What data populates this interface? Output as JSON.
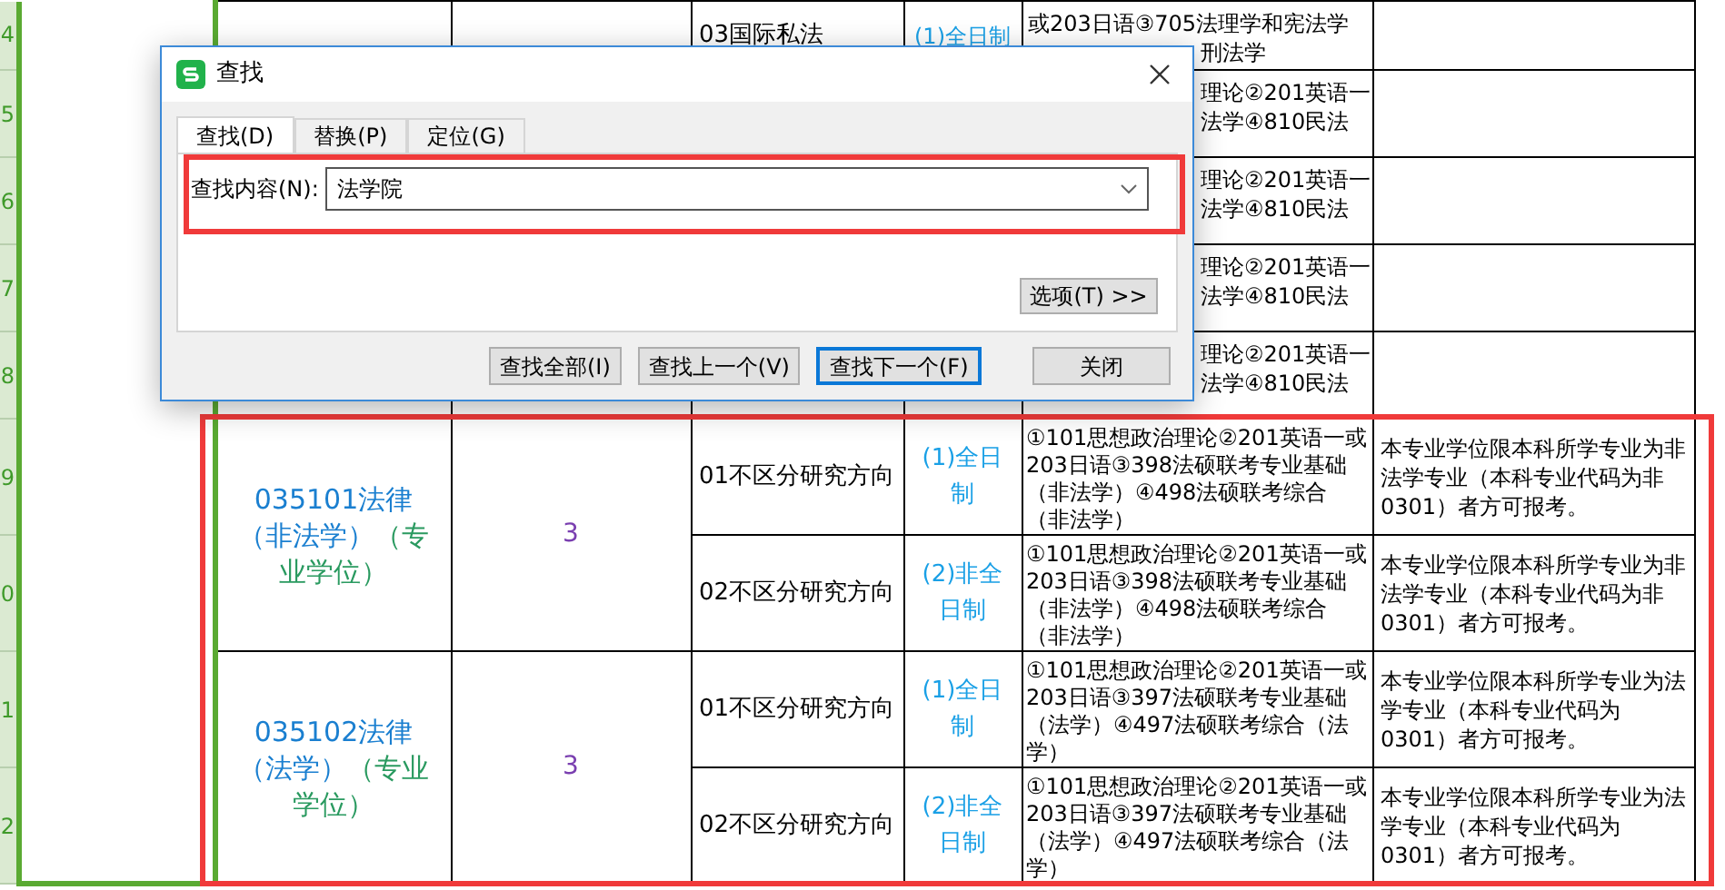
{
  "row_headers": [
    "4",
    "5",
    "6",
    "7",
    "8",
    "9",
    "0",
    "1",
    "2"
  ],
  "top_rows": [
    {
      "direction": "03国际私法",
      "mode": "(1)全日制",
      "exam_lines": [
        {
          "kind": "full",
          "text": "或203日语③705法理学和宪法学"
        },
        {
          "kind": "covered",
          "text": "刑法学"
        }
      ]
    },
    {
      "exam_lines": [
        {
          "kind": "covered",
          "text": "理论②201英语一"
        },
        {
          "kind": "covered",
          "text": "法学④810民法"
        }
      ]
    },
    {
      "exam_lines": [
        {
          "kind": "covered",
          "text": "理论②201英语一"
        },
        {
          "kind": "covered",
          "text": "法学④810民法"
        }
      ]
    },
    {
      "exam_lines": [
        {
          "kind": "covered",
          "text": "理论②201英语一"
        },
        {
          "kind": "covered",
          "text": "法学④810民法"
        }
      ]
    },
    {
      "exam_lines": [
        {
          "kind": "covered",
          "text": "理论②201英语一"
        },
        {
          "kind": "covered",
          "text": "法学④810民法"
        }
      ]
    }
  ],
  "programs": [
    {
      "name": "035101法律（非法学）",
      "degree": "（专业学位）",
      "count": "3",
      "directions": [
        {
          "direction": "01不区分研究方向",
          "mode": "(1)全日制",
          "exams": "①101思想政治理论②201英语一或203日语③398法硕联考专业基础（非法学）④498法硕联考综合（非法学）",
          "note": "本专业学位限本科所学专业为非法学专业（本科专业代码为非0301）者方可报考。"
        },
        {
          "direction": "02不区分研究方向",
          "mode": "(2)非全日制",
          "exams": "①101思想政治理论②201英语一或203日语③398法硕联考专业基础（非法学）④498法硕联考综合（非法学）",
          "note": "本专业学位限本科所学专业为非法学专业（本科专业代码为非0301）者方可报考。"
        }
      ]
    },
    {
      "name": "035102法律（法学）",
      "degree": "（专业学位）",
      "count": "3",
      "directions": [
        {
          "direction": "01不区分研究方向",
          "mode": "(1)全日制",
          "exams": "①101思想政治理论②201英语一或203日语③397法硕联考专业基础（法学）④497法硕联考综合（法学）",
          "note": "本专业学位限本科所学专业为法学专业（本科专业代码为0301）者方可报考。"
        },
        {
          "direction": "02不区分研究方向",
          "mode": "(2)非全日制",
          "exams": "①101思想政治理论②201英语一或203日语③397法硕联考专业基础（法学）④497法硕联考综合（法学）",
          "note": "本专业学位限本科所学专业为法学专业（本科专业代码为0301）者方可报考。"
        }
      ]
    }
  ],
  "dialog": {
    "title": "查找",
    "tabs": [
      {
        "label": "查找(D)",
        "selected": true
      },
      {
        "label": "替换(P)",
        "selected": false
      },
      {
        "label": "定位(G)",
        "selected": false
      }
    ],
    "find_label": "查找内容(N):",
    "find_value": "法学院",
    "options_button": "选项(T) >>",
    "buttons": [
      {
        "label": "查找全部(I)",
        "focused": false
      },
      {
        "label": "查找上一个(V)",
        "focused": false
      },
      {
        "label": "查找下一个(F)",
        "focused": true
      },
      {
        "label": "关闭",
        "focused": false
      }
    ]
  }
}
